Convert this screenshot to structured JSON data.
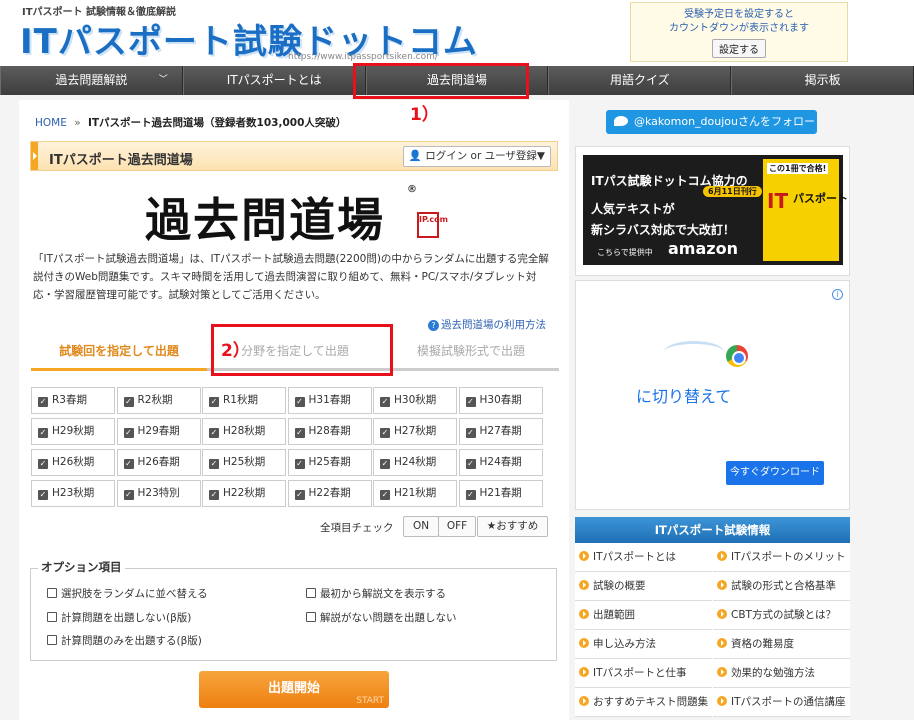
{
  "header": {
    "tagline": "ITパスポート 試験情報＆徹底解説",
    "logo_text": "ITパスポート試験ドットコム",
    "logo_url": "https://www.itpassportsiken.com/",
    "countdown_line1": "受験予定日を設定すると",
    "countdown_line2": "カウントダウンが表示されます",
    "countdown_button": "設定する"
  },
  "nav": [
    {
      "label": "過去問題解説"
    },
    {
      "label": "ITパスポートとは"
    },
    {
      "label": "過去問道場"
    },
    {
      "label": "用語クイズ"
    },
    {
      "label": "掲示板"
    }
  ],
  "annotations": {
    "label1": "1）",
    "label2": "2）"
  },
  "breadcrumb": {
    "home": "HOME",
    "sep": "»",
    "current": "ITパスポート過去問道場（登録者数103,000人突破）"
  },
  "page": {
    "title": "ITパスポート過去問道場",
    "login_button": "ログイン or ユーザ登録▼",
    "dojo_logo": "過去問道場",
    "dojo_badge": "IP.com",
    "intro": "「ITパスポート試験過去問道場」は、ITパスポート試験過去問題(2200問)の中からランダムに出題する完全解説付きのWeb問題集です。スキマ時間を活用して過去問演習に取り組めて、無料・PC/スマホ/タブレット対応・学習履歴管理可能です。試験対策としてご活用ください。",
    "usage_link": "過去問道場の利用方法"
  },
  "tabs": [
    {
      "label": "試験回を指定して出題",
      "active": true
    },
    {
      "label": "分野を指定して出題",
      "active": false
    },
    {
      "label": "模擬試験形式で出題",
      "active": false
    }
  ],
  "exams": [
    "R3春期",
    "R2秋期",
    "R1秋期",
    "H31春期",
    "H30秋期",
    "H30春期",
    "H29秋期",
    "H29春期",
    "H28秋期",
    "H28春期",
    "H27秋期",
    "H27春期",
    "H26秋期",
    "H26春期",
    "H25秋期",
    "H25春期",
    "H24秋期",
    "H24春期",
    "H23秋期",
    "H23特別",
    "H22秋期",
    "H22春期",
    "H21秋期",
    "H21春期"
  ],
  "controls": {
    "allcheck_label": "全項目チェック",
    "on": "ON",
    "off": "OFF",
    "recommended": "★おすすめ"
  },
  "options": {
    "title": "オプション項目",
    "items": [
      "選択肢をランダムに並べ替える",
      "最初から解説文を表示する",
      "計算問題を出題しない(β版)",
      "解説がない問題を出題しない",
      "計算問題のみを出題する(β版)"
    ]
  },
  "start": {
    "label": "出題開始",
    "sub": "START"
  },
  "sidebar": {
    "twitter": "@kakomon_doujouさんをフォロー",
    "banner": {
      "line1": "ITパス試験ドットコム協力の",
      "line2": "人気テキストが",
      "line3": "新シラバス対応で大改訂！",
      "date": "6月11日刊行",
      "small": "こちらで提供中",
      "amazon": "amazon",
      "book_top": "この1冊で合格!",
      "book_it": "IT",
      "book_title": "パスポート"
    },
    "ad": {
      "text": "に切り替えて",
      "button": "今すぐダウンロード"
    },
    "info_head": "ITパスポート試験情報",
    "info_items": [
      "ITパスポートとは",
      "ITパスポートのメリット",
      "試験の概要",
      "試験の形式と合格基準",
      "出題範囲",
      "CBT方式の試験とは？",
      "申し込み方法",
      "資格の難易度",
      "ITパスポートと仕事",
      "効果的な勉強方法",
      "おすすめテキスト問題集",
      "ITパスポートの通信講座"
    ]
  },
  "colors": {
    "accent": "#f5a623",
    "link": "#2a5fb0",
    "annotation": "#e8101a",
    "nav": "#4a4a4a"
  }
}
